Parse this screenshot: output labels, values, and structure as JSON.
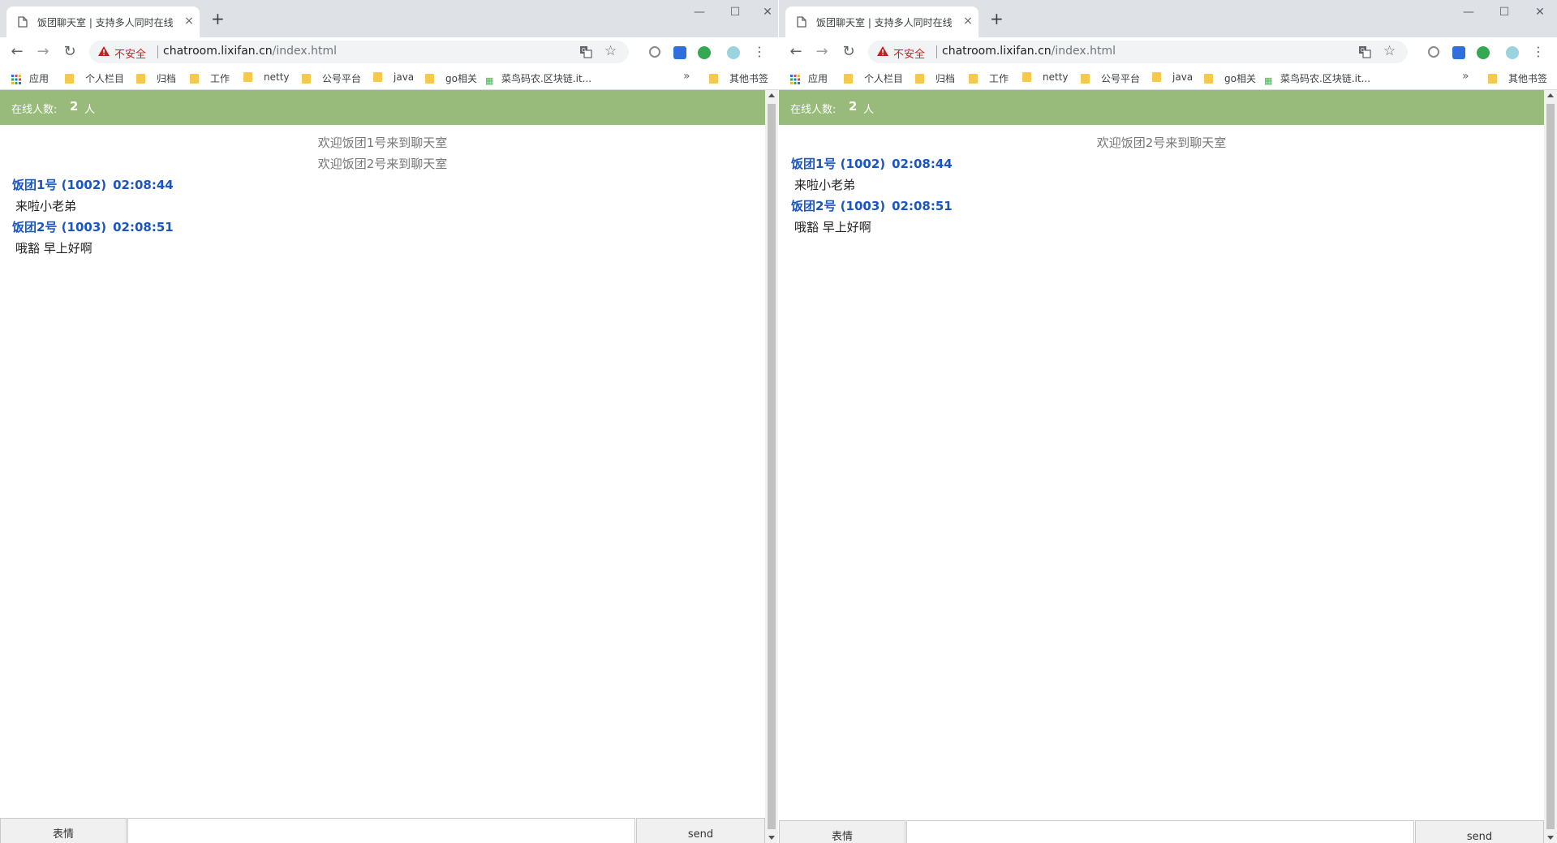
{
  "colors": {
    "online_bar": "#98bb7b",
    "user_name": "#1a54c5",
    "insecure_red": "#c5221f",
    "folder": "#f5c94a"
  },
  "windows": [
    {
      "tab": {
        "title": "饭团聊天室 | 支持多人同时在线",
        "close": "×"
      },
      "new_tab": "+",
      "window_controls": {
        "minimize": "—",
        "maximize": "☐",
        "close": "✕"
      },
      "toolbar": {
        "back": "←",
        "forward": "→",
        "reload": "↻",
        "insecure_label": "不安全",
        "url_host": "chatroom.lixifan.cn",
        "url_path": "/index.html",
        "menu": "⋮"
      },
      "bookmarks": {
        "apps": "应用",
        "items": [
          "个人栏目",
          "归档",
          "工作",
          "netty",
          "公号平台",
          "java",
          "go相关",
          "菜鸟码农.区块链.it..."
        ],
        "more": "»",
        "other": "其他书签"
      },
      "chat": {
        "online_label": "在线人数:",
        "online_count": "2",
        "online_unit": "人",
        "system_messages": [
          "欢迎饭团1号来到聊天室",
          "欢迎饭团2号来到聊天室"
        ],
        "messages": [
          {
            "user": "饭团1号 (1002)",
            "time": "02:08:44",
            "text": "来啦小老弟"
          },
          {
            "user": "饭团2号 (1003)",
            "time": "02:08:51",
            "text": "哦豁 早上好啊"
          }
        ],
        "emoji_button": "表情",
        "send_button": "send",
        "input_value": ""
      }
    },
    {
      "tab": {
        "title": "饭团聊天室 | 支持多人同时在线",
        "close": "×"
      },
      "new_tab": "+",
      "window_controls": {
        "minimize": "—",
        "maximize": "☐",
        "close": "✕"
      },
      "toolbar": {
        "back": "←",
        "forward": "→",
        "reload": "↻",
        "insecure_label": "不安全",
        "url_host": "chatroom.lixifan.cn",
        "url_path": "/index.html",
        "menu": "⋮"
      },
      "bookmarks": {
        "apps": "应用",
        "items": [
          "个人栏目",
          "归档",
          "工作",
          "netty",
          "公号平台",
          "java",
          "go相关",
          "菜鸟码农.区块链.it..."
        ],
        "more": "»",
        "other": "其他书签"
      },
      "chat": {
        "online_label": "在线人数:",
        "online_count": "2",
        "online_unit": "人",
        "system_messages": [
          "欢迎饭团2号来到聊天室"
        ],
        "messages": [
          {
            "user": "饭团1号 (1002)",
            "time": "02:08:44",
            "text": "来啦小老弟"
          },
          {
            "user": "饭团2号 (1003)",
            "time": "02:08:51",
            "text": "哦豁 早上好啊"
          }
        ],
        "emoji_button": "表情",
        "send_button": "send",
        "input_value": ""
      }
    }
  ]
}
